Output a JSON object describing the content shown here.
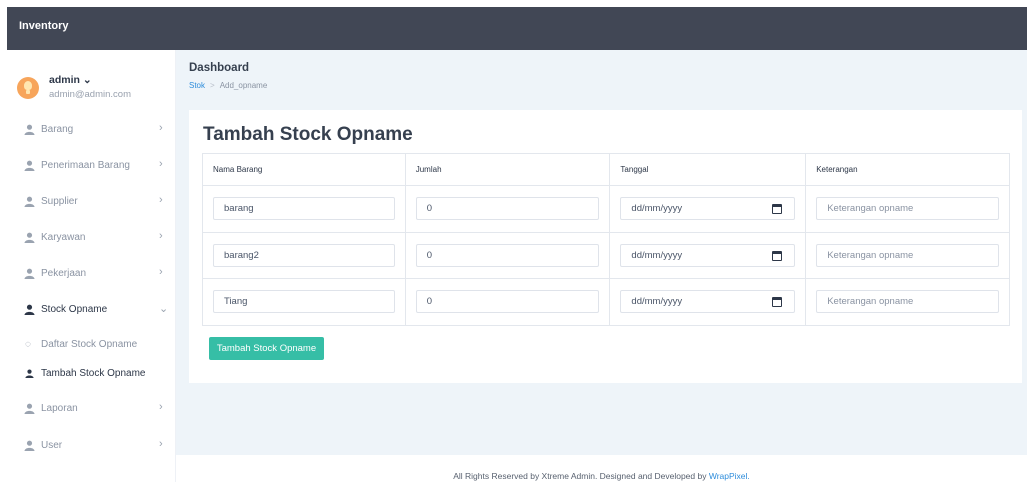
{
  "app": {
    "title": "Inventory"
  },
  "user": {
    "name": "admin",
    "email": "admin@admin.com"
  },
  "sidebar": {
    "items": [
      {
        "label": "Barang"
      },
      {
        "label": "Penerimaan Barang"
      },
      {
        "label": "Supplier"
      },
      {
        "label": "Karyawan"
      },
      {
        "label": "Pekerjaan"
      },
      {
        "label": "Stock Opname"
      },
      {
        "label": "Laporan"
      },
      {
        "label": "User"
      }
    ],
    "sub_items": [
      {
        "label": "Daftar Stock Opname"
      },
      {
        "label": "Tambah Stock Opname"
      }
    ]
  },
  "breadcrumb": {
    "title": "Dashboard",
    "link": "Stok",
    "current": "Add_opname"
  },
  "page": {
    "title": "Tambah Stock Opname"
  },
  "table": {
    "headers": [
      "Nama Barang",
      "Jumlah",
      "Tanggal",
      "Keterangan"
    ],
    "rows": [
      {
        "nama": "barang",
        "jumlah": "0",
        "tanggal": "dd/mm/yyyy",
        "keterangan": "Keterangan opname"
      },
      {
        "nama": "barang2",
        "jumlah": "0",
        "tanggal": "dd/mm/yyyy",
        "keterangan": "Keterangan opname"
      },
      {
        "nama": "Tiang",
        "jumlah": "0",
        "tanggal": "dd/mm/yyyy",
        "keterangan": "Keterangan opname"
      }
    ]
  },
  "submit_label": "Tambah Stock Opname",
  "footer": {
    "text": "All Rights Reserved by Xtreme Admin. Designed and Developed by ",
    "link": "WrapPixel."
  },
  "colors": {
    "topbar": "#414755",
    "accent": "#36bea6",
    "link": "#2d8cdb",
    "background": "#eef4f9"
  },
  "icons": {
    "nav": "user-icon",
    "arrow": "chevron-right-icon",
    "expanded": "chevron-down-icon",
    "date": "calendar-icon"
  }
}
